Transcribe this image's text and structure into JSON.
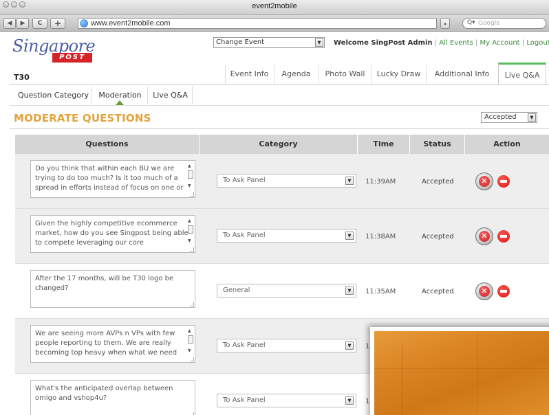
{
  "browser": {
    "window_title": "event2mobile",
    "url": "www.event2mobile.com",
    "search_placeholder": "Google",
    "nav": {
      "back": "◀",
      "forward": "▶",
      "reload": "C",
      "add": "+"
    }
  },
  "header": {
    "logo_script": "Singapore",
    "logo_post": "POST",
    "event_select": "Change Event",
    "welcome": "Welcome SingPost Admin",
    "links": {
      "all_events": "All Events",
      "my_account": "My Account",
      "logout": "Logout"
    },
    "separator": "|",
    "event_name": "T30",
    "tabs": [
      {
        "label": "Event Info"
      },
      {
        "label": "Agenda"
      },
      {
        "label": "Photo Wall"
      },
      {
        "label": "Lucky Draw"
      },
      {
        "label": "Additional Info"
      },
      {
        "label": "Live Q&A"
      }
    ],
    "active_tab": "Live Q&A",
    "accent_color": "#5cb85c"
  },
  "subtabs": [
    {
      "label": "Question Category"
    },
    {
      "label": "Moderation"
    },
    {
      "label": "Live Q&A"
    }
  ],
  "active_subtab": "Moderation",
  "page_title": "MODERATE QUESTIONS",
  "title_color": "#e3a23a",
  "filter": {
    "selected": "Accepted"
  },
  "table": {
    "headers": [
      "Questions",
      "Category",
      "Time",
      "Status",
      "Action"
    ],
    "rows": [
      {
        "question": "Do you think that within each BU we are trying to do too much? Is it too much of a spread in efforts instead of focus on one or",
        "category": "To Ask Panel",
        "time": "11:39AM",
        "status": "Accepted",
        "scroll": true
      },
      {
        "question": "Given the highly competitive ecommerce market, how do you see Singpost being able to compete leveraging our core",
        "category": "To Ask Panel",
        "time": "11:38AM",
        "status": "Accepted",
        "scroll": true
      },
      {
        "question": "After the 17 months, will be T30 logo be changed?",
        "category": "General",
        "time": "11:35AM",
        "status": "Accepted",
        "scroll": false
      },
      {
        "question": "We are seeing more AVPs n VPs with few people reporting to them. We are really becoming top heavy when what we need",
        "category": "To Ask Panel",
        "time": "1",
        "status": "",
        "scroll": true
      },
      {
        "question": "What's the anticipated overlap between omigo and vshop4u?",
        "category": "To Ask Panel",
        "time": "1",
        "status": "",
        "scroll": false
      }
    ]
  },
  "icons": {
    "reject": "reject-x-icon",
    "remove": "remove-minus-icon",
    "dropdown": "chevron-down-icon"
  },
  "colors": {
    "reject_red": "#c81e1e",
    "remove_red": "#d9141b",
    "link_green": "#3c8a3c",
    "logo_red": "#d4242a",
    "logo_blue": "#4d5ea8"
  }
}
